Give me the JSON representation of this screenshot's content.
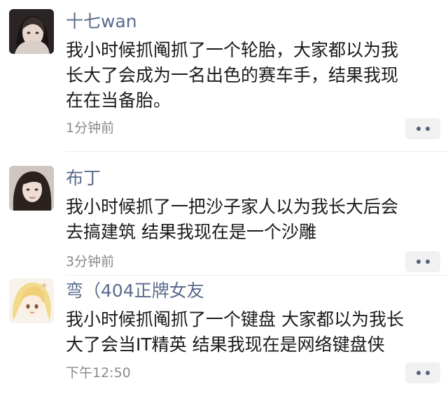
{
  "comments": [
    {
      "username": "十七wan",
      "lines": [
        "我小时候抓阄抓了一个轮胎，大家都以为我",
        "长大了会成为一名出色的赛车手，结果我现",
        "在在当备胎。"
      ],
      "time": "1分钟前",
      "avatar_icon": "girl-portrait-icon"
    },
    {
      "username": "布丁",
      "lines": [
        "我小时候抓了一把沙子家人以为我长大后会",
        "去搞建筑 结果我现在是一个沙雕"
      ],
      "time": "3分钟前",
      "avatar_icon": "girl-portrait-icon"
    },
    {
      "username": "弯（404正牌女友",
      "lines": [
        "我小时候抓阄抓了一个键盘 大家都以为我长",
        "大了会当IT精英 结果我现在是网络键盘侠"
      ],
      "time": "下午12:50",
      "avatar_icon": "anime-girl-icon"
    }
  ],
  "more_icon": "more-dots-icon"
}
